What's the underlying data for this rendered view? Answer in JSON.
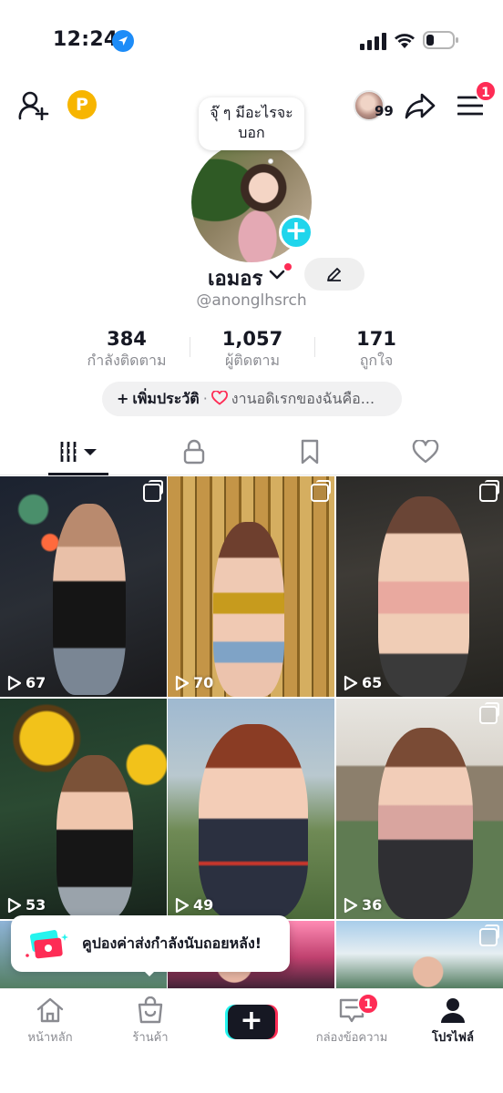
{
  "status_bar": {
    "time": "12:24"
  },
  "header": {
    "story_count": "99",
    "menu_badge": "1"
  },
  "profile": {
    "bio_bubble": "จุ๊ ๆ มีอะไรจะบอก",
    "display_name": "เอมอร",
    "username": "@anonglhsrch",
    "stats": [
      {
        "value": "384",
        "label": "กำลังติดตาม"
      },
      {
        "value": "1,057",
        "label": "ผู้ติดตาม"
      },
      {
        "value": "171",
        "label": "ถูกใจ"
      }
    ],
    "bio_pill": {
      "add_label": "เพิ่มประวัติ",
      "separator": "·",
      "text": "งานอดิเรกของฉันคือ..."
    }
  },
  "videos": [
    {
      "views": "67"
    },
    {
      "views": "70"
    },
    {
      "views": "65"
    },
    {
      "views": "53"
    },
    {
      "views": "49"
    },
    {
      "views": "36"
    }
  ],
  "coupon_toast": {
    "text": "คูปองค่าส่งกำลังนับถอยหลัง!"
  },
  "bottom_nav": {
    "home": "หน้าหลัก",
    "shop": "ร้านค้า",
    "inbox": "กล่องข้อความ",
    "inbox_badge": "1",
    "profile": "โปรไฟล์"
  },
  "colors": {
    "accent_red": "#fe2c55",
    "accent_cyan": "#25f4ee",
    "plus_blue": "#20d5ec",
    "text_primary": "#161823",
    "text_muted": "#8a8b91"
  },
  "icons": [
    "location-arrow-icon",
    "signal-icon",
    "wifi-icon",
    "battery-icon",
    "add-friend-icon",
    "coin-icon",
    "share-icon",
    "menu-icon",
    "chevron-down-icon",
    "pencil-icon",
    "grid-icon",
    "lock-icon",
    "bookmark-icon",
    "heart-icon",
    "play-icon",
    "multi-photo-icon",
    "coupon-icon",
    "home-icon",
    "shop-bag-icon",
    "plus-icon",
    "inbox-icon",
    "profile-icon"
  ]
}
